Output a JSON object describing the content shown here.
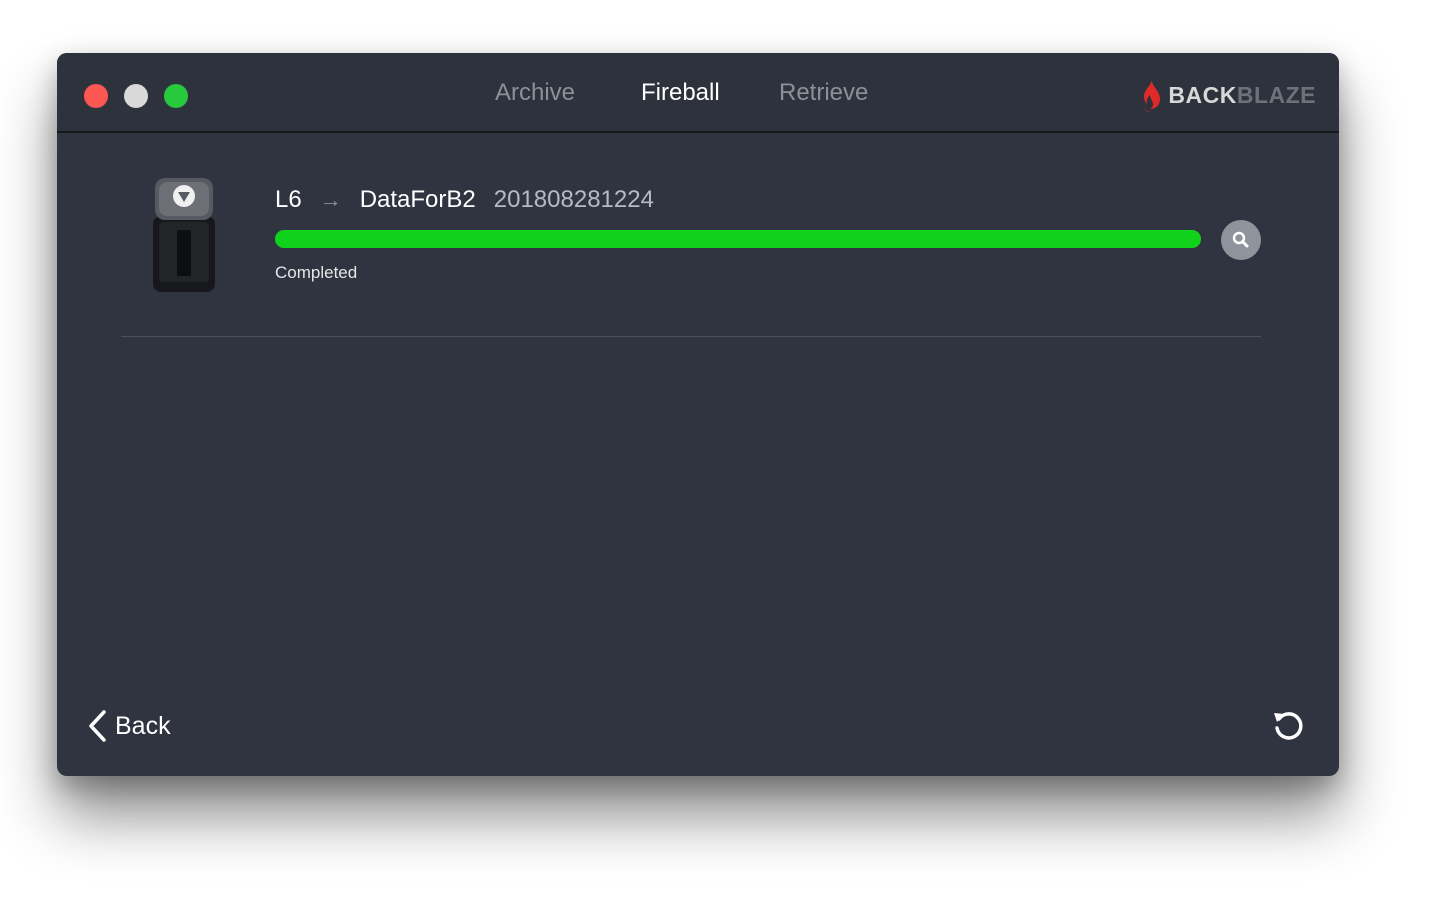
{
  "window": {
    "tabs": [
      {
        "label": "Archive",
        "active": false
      },
      {
        "label": "Fireball",
        "active": true
      },
      {
        "label": "Retrieve",
        "active": false
      }
    ],
    "brand": {
      "part1": "BACK",
      "part2": "BLAZE"
    }
  },
  "job": {
    "source": "L6",
    "destination": "DataForB2",
    "timestamp": "201808281224",
    "progress_percent": 100,
    "status": "Completed"
  },
  "footer": {
    "back_label": "Back"
  },
  "colors": {
    "progress": "#11d21b",
    "window_bg": "#2f3440",
    "brand_flame": "#e02a2a"
  }
}
